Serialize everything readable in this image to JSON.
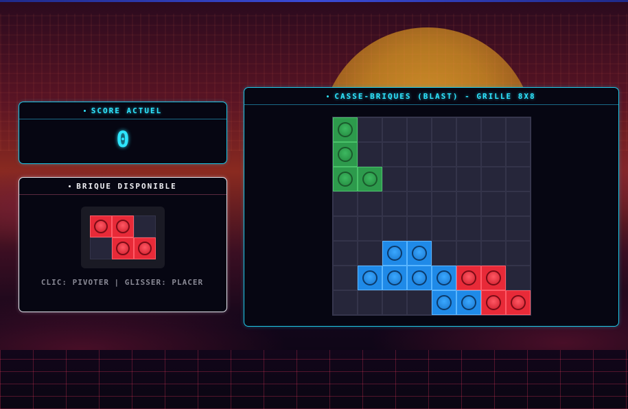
{
  "score": {
    "title": "SCORE ACTUEL",
    "value": "0"
  },
  "brick": {
    "title": "BRIQUE DISPONIBLE",
    "hint": "CLIC: PIVOTER | GLISSER: PLACER",
    "color": "red",
    "shape": [
      [
        1,
        1,
        0
      ],
      [
        0,
        1,
        1
      ]
    ]
  },
  "board": {
    "title": "CASSE-BRIQUES (BLAST) - GRILLE 8X8",
    "rows": 8,
    "cols": 8,
    "cells": [
      [
        "green",
        "",
        "",
        "",
        "",
        "",
        "",
        ""
      ],
      [
        "green",
        "",
        "",
        "",
        "",
        "",
        "",
        ""
      ],
      [
        "green",
        "green",
        "",
        "",
        "",
        "",
        "",
        ""
      ],
      [
        "",
        "",
        "",
        "",
        "",
        "",
        "",
        ""
      ],
      [
        "",
        "",
        "",
        "",
        "",
        "",
        "",
        ""
      ],
      [
        "",
        "",
        "blue",
        "blue",
        "",
        "",
        "",
        ""
      ],
      [
        "",
        "blue",
        "blue",
        "blue",
        "blue",
        "red",
        "red",
        ""
      ],
      [
        "",
        "",
        "",
        "",
        "blue",
        "blue",
        "red",
        "red"
      ]
    ]
  },
  "colors": {
    "accent": "#2ee6ff",
    "green": "#2d9a4c",
    "blue": "#1f8ae8",
    "red": "#e82a38"
  }
}
